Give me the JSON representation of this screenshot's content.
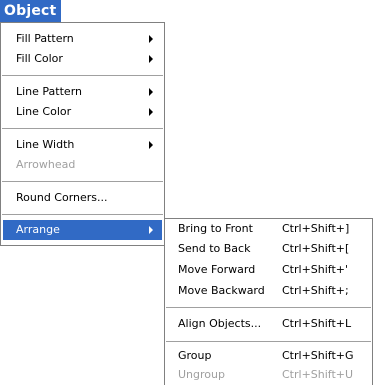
{
  "title": "Object",
  "main_menu": {
    "items": [
      {
        "label": "Fill Pattern",
        "has_submenu": true,
        "enabled": true
      },
      {
        "label": "Fill Color",
        "has_submenu": true,
        "enabled": true
      },
      {
        "label": "Line Pattern",
        "has_submenu": true,
        "enabled": true
      },
      {
        "label": "Line Color",
        "has_submenu": true,
        "enabled": true
      },
      {
        "label": "Line Width",
        "has_submenu": true,
        "enabled": true
      },
      {
        "label": "Arrowhead",
        "has_submenu": false,
        "enabled": false
      },
      {
        "label": "Round Corners...",
        "has_submenu": false,
        "enabled": true
      },
      {
        "label": "Arrange",
        "has_submenu": true,
        "enabled": true,
        "highlighted": true
      }
    ]
  },
  "arrange_submenu": {
    "items": [
      {
        "label": "Bring to Front",
        "shortcut": "Ctrl+Shift+]",
        "enabled": true
      },
      {
        "label": "Send to Back",
        "shortcut": "Ctrl+Shift+[",
        "enabled": true
      },
      {
        "label": "Move Forward",
        "shortcut": "Ctrl+Shift+'",
        "enabled": true
      },
      {
        "label": "Move Backward",
        "shortcut": "Ctrl+Shift+;",
        "enabled": true
      },
      {
        "label": "Align Objects...",
        "shortcut": "Ctrl+Shift+L",
        "enabled": true
      },
      {
        "label": "Group",
        "shortcut": "Ctrl+Shift+G",
        "enabled": true
      },
      {
        "label": "Ungroup",
        "shortcut": "Ctrl+Shift+U",
        "enabled": false
      }
    ]
  },
  "colors": {
    "highlight": "#316ac5",
    "disabled_text": "#a0a0a0",
    "border": "#808080"
  }
}
